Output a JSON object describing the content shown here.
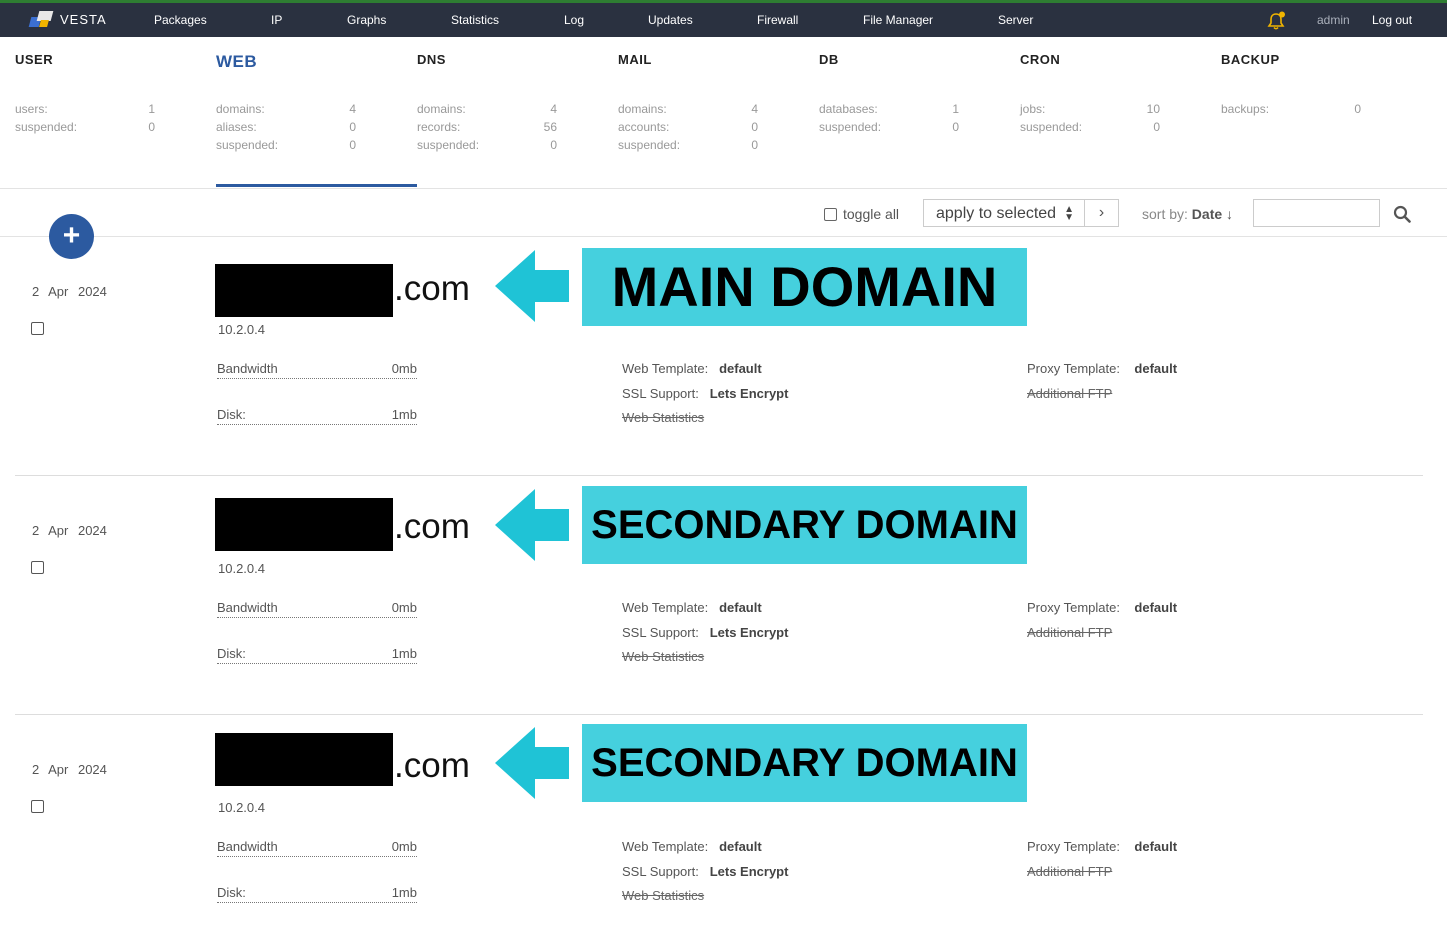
{
  "brand": "VESTA",
  "nav": [
    "Packages",
    "IP",
    "Graphs",
    "Statistics",
    "Log",
    "Updates",
    "Firewall",
    "File Manager",
    "Server"
  ],
  "user": {
    "name": "admin",
    "logout": "Log out"
  },
  "colors": {
    "topbar": "#2a3140",
    "accent": "#2c5aa0",
    "banner": "#45d0de",
    "arrow": "#1fc3d6",
    "bell": "#f0b400"
  },
  "stats": [
    {
      "title": "USER",
      "rows": [
        {
          "label": "users:",
          "value": "1"
        },
        {
          "label": "suspended:",
          "value": "0"
        }
      ]
    },
    {
      "title": "WEB",
      "active": true,
      "rows": [
        {
          "label": "domains:",
          "value": "4"
        },
        {
          "label": "aliases:",
          "value": "0"
        },
        {
          "label": "suspended:",
          "value": "0"
        }
      ]
    },
    {
      "title": "DNS",
      "rows": [
        {
          "label": "domains:",
          "value": "4"
        },
        {
          "label": "records:",
          "value": "56"
        },
        {
          "label": "suspended:",
          "value": "0"
        }
      ]
    },
    {
      "title": "MAIL",
      "rows": [
        {
          "label": "domains:",
          "value": "4"
        },
        {
          "label": "accounts:",
          "value": "0"
        },
        {
          "label": "suspended:",
          "value": "0"
        }
      ]
    },
    {
      "title": "DB",
      "rows": [
        {
          "label": "databases:",
          "value": "1"
        },
        {
          "label": "suspended:",
          "value": "0"
        }
      ]
    },
    {
      "title": "CRON",
      "rows": [
        {
          "label": "jobs:",
          "value": "10"
        },
        {
          "label": "suspended:",
          "value": "0"
        }
      ]
    },
    {
      "title": "BACKUP",
      "rows": [
        {
          "label": "backups:",
          "value": "0"
        }
      ]
    }
  ],
  "toolbar": {
    "add_icon": "plus-icon",
    "toggle_all": "toggle all",
    "apply": "apply to selected",
    "sort_label": "sort by:",
    "sort_value": "Date ↓",
    "search_placeholder": ""
  },
  "domains": [
    {
      "date": "2 Apr 2024",
      "tld": ".com",
      "ip": "10.2.0.4",
      "banner": "MAIN DOMAIN",
      "bandwidth_label": "Bandwidth",
      "bandwidth": "0mb",
      "disk_label": "Disk:",
      "disk": "1mb",
      "web_template_label": "Web Template:",
      "web_template": "default",
      "ssl_label": "SSL Support:",
      "ssl": "Lets Encrypt",
      "web_stats": "Web Statistics",
      "proxy_label": "Proxy Template:",
      "proxy": "default",
      "ftp": "Additional FTP"
    },
    {
      "date": "2 Apr 2024",
      "tld": ".com",
      "ip": "10.2.0.4",
      "banner": "SECONDARY DOMAIN",
      "bandwidth_label": "Bandwidth",
      "bandwidth": "0mb",
      "disk_label": "Disk:",
      "disk": "1mb",
      "web_template_label": "Web Template:",
      "web_template": "default",
      "ssl_label": "SSL Support:",
      "ssl": "Lets Encrypt",
      "web_stats": "Web Statistics",
      "proxy_label": "Proxy Template:",
      "proxy": "default",
      "ftp": "Additional FTP"
    },
    {
      "date": "2 Apr 2024",
      "tld": ".com",
      "ip": "10.2.0.4",
      "banner": "SECONDARY DOMAIN",
      "bandwidth_label": "Bandwidth",
      "bandwidth": "0mb",
      "disk_label": "Disk:",
      "disk": "1mb",
      "web_template_label": "Web Template:",
      "web_template": "default",
      "ssl_label": "SSL Support:",
      "ssl": "Lets Encrypt",
      "web_stats": "Web Statistics",
      "proxy_label": "Proxy Template:",
      "proxy": "default",
      "ftp": "Additional FTP"
    }
  ]
}
